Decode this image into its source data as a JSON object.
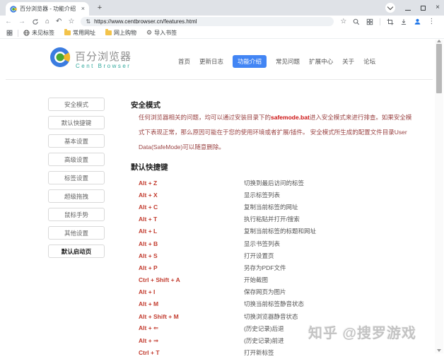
{
  "colors": {
    "accent_blue": "#4285f4",
    "key_red": "#c23b2e",
    "paragraph_red": "#9a4343",
    "highlight_red": "#cc1111",
    "logo_teal": "#2fa79b",
    "folder_yellow": "#f3c34a",
    "profile_blue": "#1a73e8"
  },
  "icons": {
    "new_tab": "+",
    "tab_close": "×",
    "back": "←",
    "forward": "→",
    "home": "⌂",
    "undo": "↶",
    "star": "☆",
    "tune": "⇅",
    "menu": "⋮",
    "gear": "⚙",
    "win_close": "×"
  },
  "browser": {
    "tab_title": "百分浏览器 - 功能介绍",
    "url": "https://www.centbrowser.cn/features.html",
    "bookmarks": [
      {
        "label": "未见标签"
      },
      {
        "label": "常用网址"
      },
      {
        "label": "网上购物"
      },
      {
        "label": "导入书签"
      }
    ]
  },
  "site": {
    "logo_title": "百分浏览器",
    "logo_subtitle": "Cent Browser",
    "nav": [
      {
        "label": "首页"
      },
      {
        "label": "更新日志"
      },
      {
        "label": "功能介绍",
        "active": true
      },
      {
        "label": "常见问题"
      },
      {
        "label": "扩展中心"
      },
      {
        "label": "关于"
      },
      {
        "label": "论坛"
      }
    ],
    "sidebar": [
      "安全模式",
      "默认快捷键",
      "基本设置",
      "高级设置",
      "标签设置",
      "超级拖拽",
      "鼠标手势",
      "其他设置",
      "默认启动页"
    ],
    "safe_mode": {
      "title": "安全模式",
      "text_before": "任何浏览器相关的问题，均可以通过安装目录下的",
      "highlight": "safemode.bat",
      "text_after": "进入安全模式来进行排查。如果安全模式下表现正常，那么原因可能在于您的使用环境或者扩展/插件。 安全模式所生成的配置文件目录User Data(SafeMode)可以随意删除。"
    },
    "shortcuts": {
      "title": "默认快捷键",
      "items": [
        {
          "keys": "Alt + Z",
          "desc": "切换到最后访问的标签"
        },
        {
          "keys": "Alt + X",
          "desc": "显示标签列表"
        },
        {
          "keys": "Alt + C",
          "desc": "复制当前标签的网址"
        },
        {
          "keys": "Alt + T",
          "desc": "执行粘贴并打开/搜索"
        },
        {
          "keys": "Alt + L",
          "desc": "复制当前标签的标题和网址"
        },
        {
          "keys": "Alt + B",
          "desc": "显示书签列表"
        },
        {
          "keys": "Alt + S",
          "desc": "打开设置页"
        },
        {
          "keys": "Alt + P",
          "desc": "另存为PDF文件"
        },
        {
          "keys": "Ctrl + Shift + A",
          "desc": "开始截图"
        },
        {
          "keys": "Alt + I",
          "desc": "保存网页为图片"
        },
        {
          "keys": "Alt + M",
          "desc": "切换当前标签静音状态"
        },
        {
          "keys": "Alt + Shift + M",
          "desc": "切换浏览器静音状态"
        },
        {
          "keys": "Alt + ⇐",
          "desc": "(历史记录)后退"
        },
        {
          "keys": "Alt + ⇒",
          "desc": "(历史记录)前进"
        },
        {
          "keys": "Ctrl + T",
          "desc": "打开新标签"
        }
      ]
    }
  },
  "watermark": "知乎 @搜罗游戏"
}
